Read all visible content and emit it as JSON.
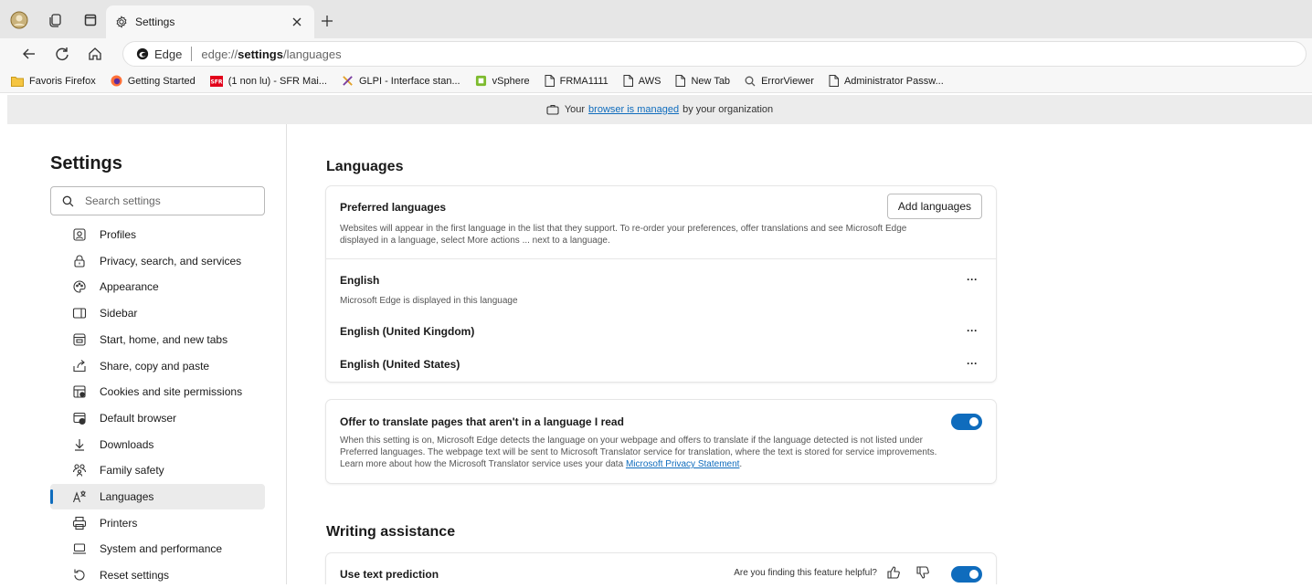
{
  "tab": {
    "title": "Settings"
  },
  "address": {
    "site": "Edge",
    "url_prefix": "edge://",
    "url_host": "settings",
    "url_path": "/languages"
  },
  "favorites": [
    {
      "label": "Favoris Firefox",
      "icon": "folder-icon"
    },
    {
      "label": "Getting Started",
      "icon": "firefox-icon"
    },
    {
      "label": "(1 non lu) - SFR Mai...",
      "icon": "sfr-icon"
    },
    {
      "label": "GLPI - Interface stan...",
      "icon": "glpi-icon"
    },
    {
      "label": "vSphere",
      "icon": "vsphere-icon"
    },
    {
      "label": "FRMA1111",
      "icon": "page-icon"
    },
    {
      "label": "AWS",
      "icon": "page-icon"
    },
    {
      "label": "New Tab",
      "icon": "page-icon"
    },
    {
      "label": "ErrorViewer",
      "icon": "search-icon"
    },
    {
      "label": "Administrator Passw...",
      "icon": "page-icon"
    }
  ],
  "managed": {
    "prefix": "Your",
    "link": "browser is managed",
    "suffix": "by your organization"
  },
  "sidebar": {
    "title": "Settings",
    "search_placeholder": "Search settings",
    "items": [
      {
        "label": "Profiles",
        "icon": "profile-icon"
      },
      {
        "label": "Privacy, search, and services",
        "icon": "lock-icon"
      },
      {
        "label": "Appearance",
        "icon": "appearance-icon"
      },
      {
        "label": "Sidebar",
        "icon": "sidebar-icon"
      },
      {
        "label": "Start, home, and new tabs",
        "icon": "home-tabs-icon"
      },
      {
        "label": "Share, copy and paste",
        "icon": "share-icon"
      },
      {
        "label": "Cookies and site permissions",
        "icon": "cookies-icon"
      },
      {
        "label": "Default browser",
        "icon": "default-browser-icon"
      },
      {
        "label": "Downloads",
        "icon": "download-icon"
      },
      {
        "label": "Family safety",
        "icon": "family-icon"
      },
      {
        "label": "Languages",
        "icon": "languages-icon"
      },
      {
        "label": "Printers",
        "icon": "printer-icon"
      },
      {
        "label": "System and performance",
        "icon": "laptop-icon"
      },
      {
        "label": "Reset settings",
        "icon": "reset-icon"
      }
    ],
    "active_index": 10
  },
  "languages": {
    "heading": "Languages",
    "preferred_title": "Preferred languages",
    "add_button": "Add languages",
    "preferred_desc_1": "Websites will appear in the first language in the list that they support. To re-order your preferences, offer translations and see Microsoft Edge",
    "preferred_desc_2": "displayed in a language, select More actions ... next to a language.",
    "list": [
      {
        "name": "English",
        "sub": "Microsoft Edge is displayed in this language"
      },
      {
        "name": "English (United Kingdom)",
        "sub": ""
      },
      {
        "name": "English (United States)",
        "sub": ""
      }
    ],
    "more_actions": "···"
  },
  "translate": {
    "title": "Offer to translate pages that aren't in a language I read",
    "desc_1": "When this setting is on, Microsoft Edge detects the language on your webpage and offers to translate if the language detected is not listed under",
    "desc_2": "Preferred languages. The webpage text will be sent to Microsoft Translator service for translation, where the text is stored for service improvements.",
    "desc_3": "Learn more about how the Microsoft Translator service uses your data",
    "link": "Microsoft Privacy Statement",
    "link_suffix": ".",
    "enabled": true
  },
  "writing": {
    "heading": "Writing assistance",
    "prediction_title": "Use text prediction",
    "helpful": "Are you finding this feature helpful?",
    "enabled": true
  },
  "colors": {
    "accent": "#0f6cbd",
    "tabstrip": "#e6e6e6",
    "toolbar": "#f7f7f7",
    "banner": "#ececec"
  }
}
